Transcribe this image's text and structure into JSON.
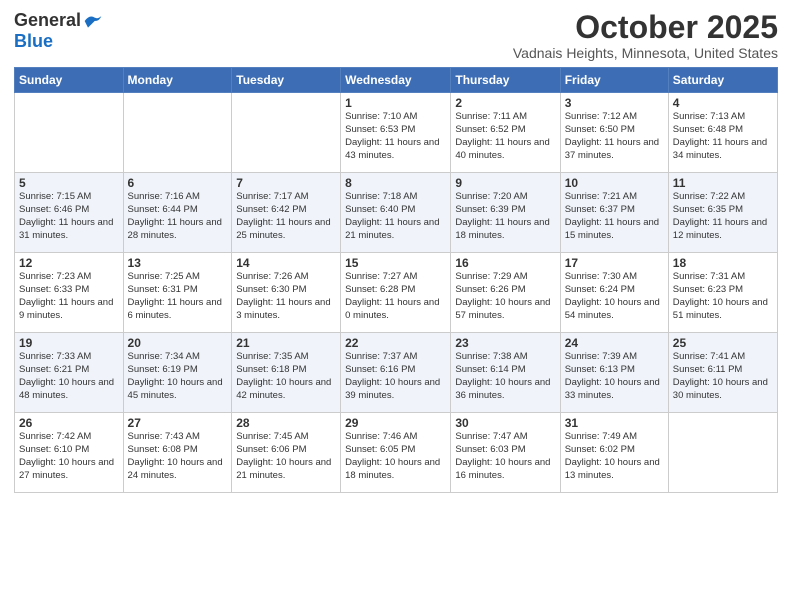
{
  "header": {
    "logo_general": "General",
    "logo_blue": "Blue",
    "month_title": "October 2025",
    "location": "Vadnais Heights, Minnesota, United States"
  },
  "days_of_week": [
    "Sunday",
    "Monday",
    "Tuesday",
    "Wednesday",
    "Thursday",
    "Friday",
    "Saturday"
  ],
  "weeks": [
    [
      {
        "day": "",
        "info": ""
      },
      {
        "day": "",
        "info": ""
      },
      {
        "day": "",
        "info": ""
      },
      {
        "day": "1",
        "info": "Sunrise: 7:10 AM\nSunset: 6:53 PM\nDaylight: 11 hours\nand 43 minutes."
      },
      {
        "day": "2",
        "info": "Sunrise: 7:11 AM\nSunset: 6:52 PM\nDaylight: 11 hours\nand 40 minutes."
      },
      {
        "day": "3",
        "info": "Sunrise: 7:12 AM\nSunset: 6:50 PM\nDaylight: 11 hours\nand 37 minutes."
      },
      {
        "day": "4",
        "info": "Sunrise: 7:13 AM\nSunset: 6:48 PM\nDaylight: 11 hours\nand 34 minutes."
      }
    ],
    [
      {
        "day": "5",
        "info": "Sunrise: 7:15 AM\nSunset: 6:46 PM\nDaylight: 11 hours\nand 31 minutes."
      },
      {
        "day": "6",
        "info": "Sunrise: 7:16 AM\nSunset: 6:44 PM\nDaylight: 11 hours\nand 28 minutes."
      },
      {
        "day": "7",
        "info": "Sunrise: 7:17 AM\nSunset: 6:42 PM\nDaylight: 11 hours\nand 25 minutes."
      },
      {
        "day": "8",
        "info": "Sunrise: 7:18 AM\nSunset: 6:40 PM\nDaylight: 11 hours\nand 21 minutes."
      },
      {
        "day": "9",
        "info": "Sunrise: 7:20 AM\nSunset: 6:39 PM\nDaylight: 11 hours\nand 18 minutes."
      },
      {
        "day": "10",
        "info": "Sunrise: 7:21 AM\nSunset: 6:37 PM\nDaylight: 11 hours\nand 15 minutes."
      },
      {
        "day": "11",
        "info": "Sunrise: 7:22 AM\nSunset: 6:35 PM\nDaylight: 11 hours\nand 12 minutes."
      }
    ],
    [
      {
        "day": "12",
        "info": "Sunrise: 7:23 AM\nSunset: 6:33 PM\nDaylight: 11 hours\nand 9 minutes."
      },
      {
        "day": "13",
        "info": "Sunrise: 7:25 AM\nSunset: 6:31 PM\nDaylight: 11 hours\nand 6 minutes."
      },
      {
        "day": "14",
        "info": "Sunrise: 7:26 AM\nSunset: 6:30 PM\nDaylight: 11 hours\nand 3 minutes."
      },
      {
        "day": "15",
        "info": "Sunrise: 7:27 AM\nSunset: 6:28 PM\nDaylight: 11 hours\nand 0 minutes."
      },
      {
        "day": "16",
        "info": "Sunrise: 7:29 AM\nSunset: 6:26 PM\nDaylight: 10 hours\nand 57 minutes."
      },
      {
        "day": "17",
        "info": "Sunrise: 7:30 AM\nSunset: 6:24 PM\nDaylight: 10 hours\nand 54 minutes."
      },
      {
        "day": "18",
        "info": "Sunrise: 7:31 AM\nSunset: 6:23 PM\nDaylight: 10 hours\nand 51 minutes."
      }
    ],
    [
      {
        "day": "19",
        "info": "Sunrise: 7:33 AM\nSunset: 6:21 PM\nDaylight: 10 hours\nand 48 minutes."
      },
      {
        "day": "20",
        "info": "Sunrise: 7:34 AM\nSunset: 6:19 PM\nDaylight: 10 hours\nand 45 minutes."
      },
      {
        "day": "21",
        "info": "Sunrise: 7:35 AM\nSunset: 6:18 PM\nDaylight: 10 hours\nand 42 minutes."
      },
      {
        "day": "22",
        "info": "Sunrise: 7:37 AM\nSunset: 6:16 PM\nDaylight: 10 hours\nand 39 minutes."
      },
      {
        "day": "23",
        "info": "Sunrise: 7:38 AM\nSunset: 6:14 PM\nDaylight: 10 hours\nand 36 minutes."
      },
      {
        "day": "24",
        "info": "Sunrise: 7:39 AM\nSunset: 6:13 PM\nDaylight: 10 hours\nand 33 minutes."
      },
      {
        "day": "25",
        "info": "Sunrise: 7:41 AM\nSunset: 6:11 PM\nDaylight: 10 hours\nand 30 minutes."
      }
    ],
    [
      {
        "day": "26",
        "info": "Sunrise: 7:42 AM\nSunset: 6:10 PM\nDaylight: 10 hours\nand 27 minutes."
      },
      {
        "day": "27",
        "info": "Sunrise: 7:43 AM\nSunset: 6:08 PM\nDaylight: 10 hours\nand 24 minutes."
      },
      {
        "day": "28",
        "info": "Sunrise: 7:45 AM\nSunset: 6:06 PM\nDaylight: 10 hours\nand 21 minutes."
      },
      {
        "day": "29",
        "info": "Sunrise: 7:46 AM\nSunset: 6:05 PM\nDaylight: 10 hours\nand 18 minutes."
      },
      {
        "day": "30",
        "info": "Sunrise: 7:47 AM\nSunset: 6:03 PM\nDaylight: 10 hours\nand 16 minutes."
      },
      {
        "day": "31",
        "info": "Sunrise: 7:49 AM\nSunset: 6:02 PM\nDaylight: 10 hours\nand 13 minutes."
      },
      {
        "day": "",
        "info": ""
      }
    ]
  ]
}
